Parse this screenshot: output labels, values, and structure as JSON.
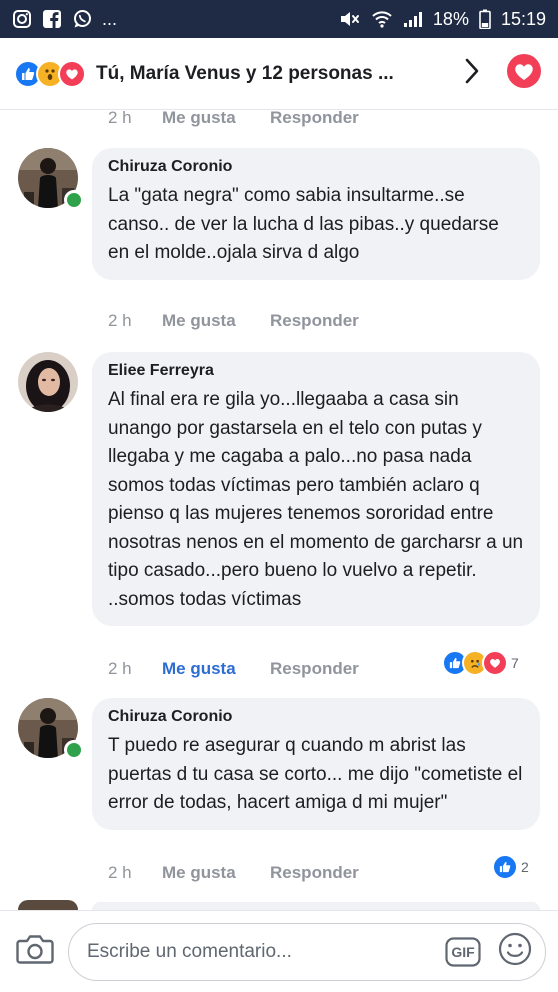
{
  "status_bar": {
    "ellipsis": "...",
    "battery": "18%",
    "time": "15:19"
  },
  "header": {
    "title": "Tú, María Venus y 12 personas ..."
  },
  "actions": {
    "like": "Me gusta",
    "reply": "Responder"
  },
  "comments": [
    {
      "name": "",
      "text": "",
      "time": "2 h",
      "partial": true
    },
    {
      "name": "Chiruza Coronio",
      "text": "La \"gata negra\" como sabia insultarme..se canso.. de ver la lucha d las pibas..y quedarse en el molde..ojala sirva d algo",
      "time": "2 h"
    },
    {
      "name": "Eliee Ferreyra",
      "text": "Al final era re gila yo...llegaaba a casa sin unango por gastarsela en el telo con putas y llegaba y me cagaba a palo...no pasa nada somos todas víctimas pero también aclaro q pienso q las mujeres tenemos sororidad entre nosotras nenos en el momento de garcharsr a un tipo casado...pero bueno lo vuelvo a repetir. ..somos todas víctimas",
      "time": "2 h",
      "liked": true,
      "reaction_count": "7"
    },
    {
      "name": "Chiruza Coronio",
      "text": "T puedo re asegurar q cuando m abrist las puertas d tu casa se corto... me dijo \"cometiste el error de todas, hacert amiga d mi mujer\"",
      "time": "2 h",
      "reaction_count": "2"
    }
  ],
  "composer": {
    "placeholder": "Escribe un comentario...",
    "gif_label": "GIF"
  },
  "colors": {
    "status_bar": "#1f2a44",
    "like_blue": "#1877f2",
    "love_red": "#f33e58",
    "online_green": "#31a24c",
    "bubble": "#f0f2f5",
    "muted": "#90949c"
  }
}
